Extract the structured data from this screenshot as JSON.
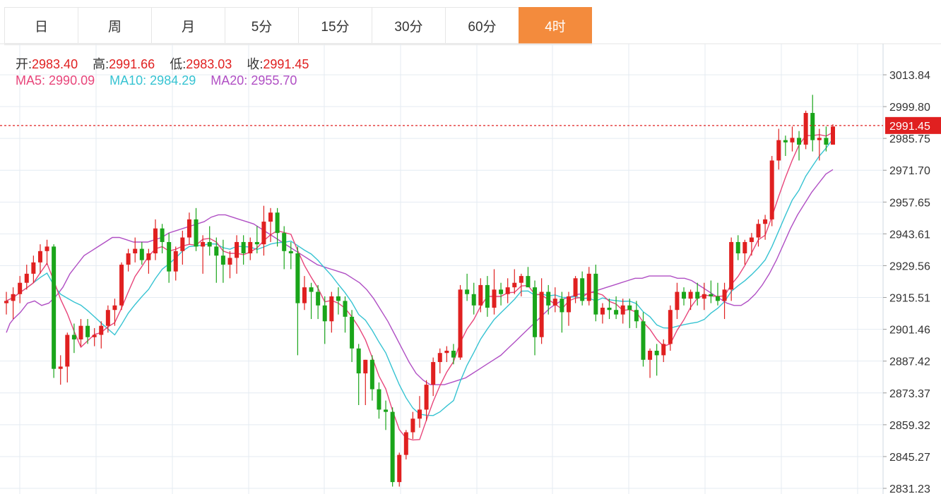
{
  "tabs": [
    {
      "label": "日",
      "active": false
    },
    {
      "label": "周",
      "active": false
    },
    {
      "label": "月",
      "active": false
    },
    {
      "label": "5分",
      "active": false
    },
    {
      "label": "15分",
      "active": false
    },
    {
      "label": "30分",
      "active": false
    },
    {
      "label": "60分",
      "active": false
    },
    {
      "label": "4时",
      "active": true
    }
  ],
  "ohlc": {
    "open_label": "开:",
    "open": "2983.40",
    "high_label": "高:",
    "high": "2991.66",
    "low_label": "低:",
    "low": "2983.03",
    "close_label": "收:",
    "close": "2991.45"
  },
  "ma": {
    "ma5_label": "MA5:",
    "ma5": "2990.09",
    "ma10_label": "MA10:",
    "ma10": "2984.29",
    "ma20_label": "MA20:",
    "ma20": "2955.70"
  },
  "colors": {
    "up": "#e02020",
    "down": "#1aa51a",
    "ma5": "#e8457a",
    "ma10": "#36c3d2",
    "ma20": "#b04fc4",
    "grid": "#e4ebf2",
    "active_tab": "#f38b3d"
  },
  "chart_data": {
    "type": "candlestick",
    "ylim": [
      2831.23,
      3013.84
    ],
    "yticks": [
      "3013.84",
      "2999.80",
      "2985.75",
      "2971.70",
      "2957.65",
      "2943.61",
      "2929.56",
      "2915.51",
      "2901.46",
      "2887.42",
      "2873.37",
      "2859.32",
      "2845.27",
      "2831.23"
    ],
    "last_price": 2991.45,
    "last_price_label": "2991.45",
    "candles": [
      [
        2913,
        2918,
        2908,
        2914
      ],
      [
        2914,
        2920,
        2906,
        2917
      ],
      [
        2917,
        2925,
        2913,
        2922
      ],
      [
        2922,
        2930,
        2919,
        2926
      ],
      [
        2926,
        2934,
        2922,
        2931
      ],
      [
        2931,
        2939,
        2926,
        2936
      ],
      [
        2936,
        2941,
        2930,
        2938
      ],
      [
        2938,
        2939,
        2880,
        2884
      ],
      [
        2884,
        2890,
        2877,
        2885
      ],
      [
        2885,
        2900,
        2878,
        2899
      ],
      [
        2899,
        2904,
        2891,
        2897
      ],
      [
        2897,
        2906,
        2894,
        2903
      ],
      [
        2903,
        2906,
        2895,
        2898
      ],
      [
        2898,
        2902,
        2894,
        2899
      ],
      [
        2899,
        2905,
        2893,
        2903
      ],
      [
        2903,
        2912,
        2900,
        2910
      ],
      [
        2910,
        2915,
        2903,
        2912
      ],
      [
        2912,
        2931,
        2910,
        2930
      ],
      [
        2930,
        2937,
        2927,
        2935
      ],
      [
        2935,
        2942,
        2931,
        2937
      ],
      [
        2937,
        2940,
        2930,
        2932
      ],
      [
        2932,
        2937,
        2926,
        2935
      ],
      [
        2935,
        2950,
        2932,
        2946
      ],
      [
        2946,
        2948,
        2935,
        2940
      ],
      [
        2940,
        2944,
        2922,
        2927
      ],
      [
        2927,
        2938,
        2923,
        2936
      ],
      [
        2936,
        2945,
        2930,
        2942
      ],
      [
        2942,
        2953,
        2939,
        2950
      ],
      [
        2950,
        2955,
        2936,
        2938
      ],
      [
        2938,
        2943,
        2926,
        2940
      ],
      [
        2940,
        2947,
        2934,
        2938
      ],
      [
        2938,
        2942,
        2922,
        2934
      ],
      [
        2934,
        2941,
        2922,
        2930
      ],
      [
        2930,
        2936,
        2924,
        2933
      ],
      [
        2933,
        2943,
        2926,
        2940
      ],
      [
        2940,
        2943,
        2930,
        2935
      ],
      [
        2935,
        2942,
        2932,
        2940
      ],
      [
        2940,
        2947,
        2935,
        2939
      ],
      [
        2939,
        2956,
        2934,
        2949
      ],
      [
        2949,
        2955,
        2940,
        2953
      ],
      [
        2953,
        2955,
        2938,
        2944
      ],
      [
        2944,
        2947,
        2928,
        2936
      ],
      [
        2936,
        2940,
        2928,
        2935
      ],
      [
        2935,
        2938,
        2890,
        2913
      ],
      [
        2913,
        2925,
        2910,
        2920
      ],
      [
        2920,
        2922,
        2906,
        2918
      ],
      [
        2918,
        2921,
        2906,
        2912
      ],
      [
        2912,
        2916,
        2895,
        2905
      ],
      [
        2905,
        2918,
        2900,
        2916
      ],
      [
        2916,
        2920,
        2908,
        2914
      ],
      [
        2914,
        2916,
        2900,
        2907
      ],
      [
        2907,
        2910,
        2887,
        2893
      ],
      [
        2893,
        2895,
        2868,
        2882
      ],
      [
        2882,
        2888,
        2868,
        2888
      ],
      [
        2888,
        2890,
        2870,
        2875
      ],
      [
        2875,
        2878,
        2862,
        2866
      ],
      [
        2866,
        2870,
        2857,
        2865
      ],
      [
        2865,
        2867,
        2832,
        2834
      ],
      [
        2834,
        2847,
        2832,
        2846
      ],
      [
        2846,
        2857,
        2844,
        2856
      ],
      [
        2856,
        2865,
        2853,
        2862
      ],
      [
        2862,
        2872,
        2858,
        2866
      ],
      [
        2866,
        2879,
        2861,
        2877
      ],
      [
        2877,
        2889,
        2872,
        2887
      ],
      [
        2887,
        2893,
        2882,
        2891
      ],
      [
        2891,
        2894,
        2887,
        2892
      ],
      [
        2892,
        2895,
        2886,
        2889
      ],
      [
        2889,
        2921,
        2888,
        2919
      ],
      [
        2919,
        2926,
        2914,
        2917
      ],
      [
        2917,
        2922,
        2908,
        2912
      ],
      [
        2912,
        2924,
        2909,
        2921
      ],
      [
        2921,
        2925,
        2907,
        2911
      ],
      [
        2911,
        2928,
        2908,
        2919
      ],
      [
        2919,
        2922,
        2912,
        2917
      ],
      [
        2917,
        2924,
        2913,
        2920
      ],
      [
        2920,
        2928,
        2917,
        2922
      ],
      [
        2922,
        2926,
        2916,
        2925
      ],
      [
        2925,
        2929,
        2921,
        2920
      ],
      [
        2920,
        2923,
        2890,
        2898
      ],
      [
        2898,
        2924,
        2895,
        2918
      ],
      [
        2918,
        2921,
        2908,
        2912
      ],
      [
        2912,
        2920,
        2909,
        2915
      ],
      [
        2915,
        2918,
        2900,
        2909
      ],
      [
        2909,
        2918,
        2903,
        2916
      ],
      [
        2916,
        2925,
        2913,
        2924
      ],
      [
        2924,
        2927,
        2912,
        2914
      ],
      [
        2914,
        2929,
        2912,
        2926
      ],
      [
        2926,
        2930,
        2905,
        2908
      ],
      [
        2908,
        2913,
        2904,
        2911
      ],
      [
        2911,
        2915,
        2906,
        2910
      ],
      [
        2910,
        2916,
        2906,
        2908
      ],
      [
        2908,
        2915,
        2904,
        2912
      ],
      [
        2912,
        2915,
        2902,
        2910
      ],
      [
        2910,
        2914,
        2902,
        2905
      ],
      [
        2905,
        2909,
        2885,
        2888
      ],
      [
        2888,
        2893,
        2880,
        2892
      ],
      [
        2892,
        2895,
        2881,
        2890
      ],
      [
        2890,
        2897,
        2887,
        2895
      ],
      [
        2895,
        2912,
        2892,
        2910
      ],
      [
        2910,
        2922,
        2906,
        2918
      ],
      [
        2918,
        2920,
        2912,
        2915
      ],
      [
        2915,
        2919,
        2910,
        2918
      ],
      [
        2918,
        2922,
        2912,
        2915
      ],
      [
        2915,
        2922,
        2910,
        2917
      ],
      [
        2917,
        2923,
        2913,
        2916
      ],
      [
        2916,
        2922,
        2912,
        2914
      ],
      [
        2914,
        2922,
        2906,
        2919
      ],
      [
        2919,
        2942,
        2914,
        2940
      ],
      [
        2940,
        2943,
        2932,
        2935
      ],
      [
        2935,
        2941,
        2930,
        2940
      ],
      [
        2940,
        2944,
        2934,
        2942
      ],
      [
        2942,
        2950,
        2938,
        2948
      ],
      [
        2948,
        2952,
        2941,
        2950
      ],
      [
        2950,
        2978,
        2947,
        2976
      ],
      [
        2976,
        2990,
        2972,
        2985
      ],
      [
        2985,
        2987,
        2978,
        2984
      ],
      [
        2984,
        2991,
        2980,
        2986
      ],
      [
        2986,
        2989,
        2976,
        2983
      ],
      [
        2983,
        2998,
        2981,
        2997
      ],
      [
        2997,
        3005,
        2980,
        2985
      ],
      [
        2985,
        2990,
        2976,
        2986
      ],
      [
        2986,
        2991,
        2980,
        2983
      ],
      [
        2983,
        2992,
        2983,
        2991
      ]
    ],
    "ma20": [
      [
        0,
        2900
      ],
      [
        5,
        2904
      ],
      [
        10,
        2906
      ],
      [
        20,
        2909
      ],
      [
        30,
        2913
      ],
      [
        40,
        2914
      ],
      [
        50,
        2912
      ],
      [
        60,
        2913
      ],
      [
        70,
        2916
      ],
      [
        80,
        2920
      ],
      [
        90,
        2926
      ],
      [
        100,
        2930
      ],
      [
        110,
        2934
      ],
      [
        120,
        2936
      ],
      [
        130,
        2938
      ],
      [
        140,
        2940
      ],
      [
        150,
        2942
      ],
      [
        160,
        2942
      ],
      [
        170,
        2941
      ],
      [
        180,
        2940
      ],
      [
        190,
        2940
      ],
      [
        200,
        2940
      ],
      [
        210,
        2941
      ],
      [
        220,
        2942
      ],
      [
        230,
        2944
      ],
      [
        240,
        2945
      ],
      [
        250,
        2946
      ],
      [
        260,
        2947
      ],
      [
        270,
        2948
      ],
      [
        280,
        2949
      ],
      [
        290,
        2951
      ],
      [
        300,
        2952
      ],
      [
        310,
        2952
      ],
      [
        320,
        2951
      ],
      [
        330,
        2950
      ],
      [
        340,
        2949
      ],
      [
        350,
        2948
      ],
      [
        360,
        2946
      ],
      [
        370,
        2944
      ],
      [
        380,
        2942
      ],
      [
        390,
        2940
      ],
      [
        400,
        2938
      ],
      [
        410,
        2936
      ],
      [
        420,
        2934
      ],
      [
        430,
        2932
      ],
      [
        440,
        2930
      ],
      [
        450,
        2929
      ],
      [
        460,
        2928
      ],
      [
        470,
        2927
      ],
      [
        480,
        2926
      ],
      [
        490,
        2924
      ],
      [
        500,
        2922
      ],
      [
        510,
        2919
      ],
      [
        520,
        2915
      ],
      [
        530,
        2910
      ],
      [
        540,
        2905
      ],
      [
        550,
        2899
      ],
      [
        560,
        2893
      ],
      [
        570,
        2887
      ],
      [
        580,
        2882
      ],
      [
        590,
        2879
      ],
      [
        600,
        2877
      ],
      [
        610,
        2877
      ],
      [
        620,
        2877
      ],
      [
        630,
        2878
      ],
      [
        640,
        2879
      ],
      [
        650,
        2880
      ],
      [
        660,
        2882
      ],
      [
        670,
        2884
      ],
      [
        680,
        2886
      ],
      [
        690,
        2888
      ],
      [
        700,
        2890
      ],
      [
        710,
        2893
      ],
      [
        720,
        2896
      ],
      [
        730,
        2899
      ],
      [
        740,
        2902
      ],
      [
        750,
        2905
      ],
      [
        760,
        2908
      ],
      [
        770,
        2911
      ],
      [
        780,
        2913
      ],
      [
        790,
        2915
      ],
      [
        800,
        2916
      ],
      [
        810,
        2917
      ],
      [
        820,
        2917
      ],
      [
        830,
        2918
      ],
      [
        840,
        2919
      ],
      [
        850,
        2920
      ],
      [
        860,
        2921
      ],
      [
        870,
        2922
      ],
      [
        880,
        2923
      ],
      [
        890,
        2924
      ],
      [
        900,
        2924
      ],
      [
        910,
        2925
      ],
      [
        920,
        2925
      ],
      [
        930,
        2925
      ],
      [
        940,
        2925
      ],
      [
        950,
        2924
      ],
      [
        960,
        2924
      ],
      [
        970,
        2923
      ],
      [
        980,
        2921
      ],
      [
        990,
        2919
      ],
      [
        1000,
        2917
      ],
      [
        1010,
        2915
      ],
      [
        1020,
        2913
      ],
      [
        1030,
        2912
      ],
      [
        1040,
        2912
      ],
      [
        1050,
        2914
      ],
      [
        1060,
        2917
      ],
      [
        1070,
        2921
      ],
      [
        1080,
        2926
      ],
      [
        1090,
        2932
      ],
      [
        1100,
        2939
      ],
      [
        1110,
        2946
      ],
      [
        1120,
        2952
      ],
      [
        1130,
        2957
      ],
      [
        1140,
        2962
      ],
      [
        1150,
        2966
      ],
      [
        1160,
        2970
      ],
      [
        1170,
        2972
      ]
    ]
  }
}
